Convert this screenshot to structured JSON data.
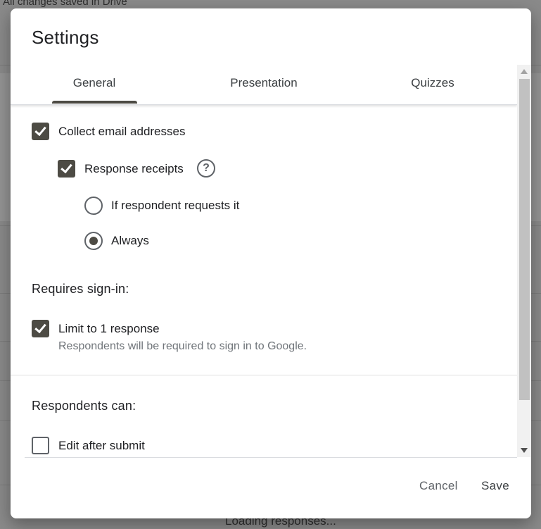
{
  "background": {
    "saved_status": "All changes saved in Drive",
    "loading_text": "Loading responses..."
  },
  "dialog": {
    "title": "Settings",
    "tabs": [
      {
        "label": "General",
        "active": true
      },
      {
        "label": "Presentation",
        "active": false
      },
      {
        "label": "Quizzes",
        "active": false
      }
    ],
    "general": {
      "collect_email": {
        "label": "Collect email addresses",
        "checked": true
      },
      "response_receipts": {
        "label": "Response receipts",
        "checked": true,
        "help_icon": "help-circle-icon"
      },
      "receipt_options": [
        {
          "label": "If respondent requests it",
          "selected": false
        },
        {
          "label": "Always",
          "selected": true
        }
      ],
      "requires_signin": {
        "heading": "Requires sign-in:",
        "limit_one": {
          "label": "Limit to 1 response",
          "description": "Respondents will be required to sign in to Google.",
          "checked": true
        }
      },
      "respondents_can": {
        "heading": "Respondents can:",
        "edit_after_submit": {
          "label": "Edit after submit",
          "checked": false
        }
      }
    },
    "buttons": {
      "cancel": "Cancel",
      "save": "Save"
    }
  },
  "colors": {
    "accent": "#4d4b44",
    "overlay": "#8a8a8a"
  }
}
